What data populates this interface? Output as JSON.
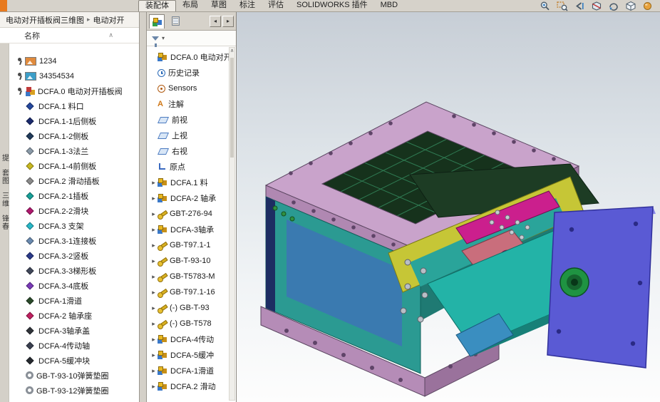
{
  "toolbar": {
    "tabs": [
      {
        "label": "装配体",
        "active": true
      },
      {
        "label": "布局",
        "active": false
      },
      {
        "label": "草图",
        "active": false
      },
      {
        "label": "标注",
        "active": false
      },
      {
        "label": "评估",
        "active": false
      },
      {
        "label": "SOLIDWORKS 插件",
        "active": false
      },
      {
        "label": "MBD",
        "active": false
      }
    ],
    "right_icons": [
      {
        "name": "zoom-to-fit-icon"
      },
      {
        "name": "zoom-area-icon"
      },
      {
        "name": "previous-view-icon"
      },
      {
        "name": "section-view-icon"
      },
      {
        "name": "rotate-view-icon"
      },
      {
        "name": "display-style-icon"
      },
      {
        "name": "edit-appearance-icon"
      }
    ]
  },
  "breadcrumb": {
    "root": "电动对开插板阀三维图",
    "separator": "▸",
    "current": "电动对开"
  },
  "side_tabs": [
    "提",
    "套图",
    "三维",
    "锋春"
  ],
  "file_panel": {
    "name_header": "名称",
    "sort_indicator": "∧",
    "items": [
      {
        "label": "1234",
        "icon": "jpg-file-icon",
        "color": "#e08a3c",
        "pinned": true
      },
      {
        "label": "34354534",
        "icon": "jpg-file-icon",
        "color": "#3c9ec8",
        "pinned": true
      },
      {
        "label": "DCFA.0 电动对开插板阀",
        "icon": "assembly-file-icon",
        "color": "#c03a3a",
        "pinned": true
      },
      {
        "label": "DCFA.1 料口",
        "icon": "part-icon",
        "color": "#24489e",
        "pinned": false
      },
      {
        "label": "DCFA.1-1后侧板",
        "icon": "part-icon",
        "color": "#1a2a6e",
        "pinned": false
      },
      {
        "label": "DCFA.1-2侧板",
        "icon": "part-icon",
        "color": "#203a5a",
        "pinned": false
      },
      {
        "label": "DCFA.1-3法兰",
        "icon": "part-icon",
        "color": "#8a9aa8",
        "pinned": false
      },
      {
        "label": "DCFA.1-4前侧板",
        "icon": "part-icon",
        "color": "#c8b820",
        "pinned": false
      },
      {
        "label": "DCFA.2 滑动插板",
        "icon": "part-icon",
        "color": "#8a8a8a",
        "pinned": false
      },
      {
        "label": "DCFA.2-1插板",
        "icon": "part-icon",
        "color": "#17a098",
        "pinned": false
      },
      {
        "label": "DCFA.2-2滑块",
        "icon": "part-icon",
        "color": "#b0186e",
        "pinned": false
      },
      {
        "label": "DCFA.3 支架",
        "icon": "part-icon",
        "color": "#28b8c8",
        "pinned": false
      },
      {
        "label": "DCFA.3-1连接板",
        "icon": "part-icon",
        "color": "#6a8ab0",
        "pinned": false
      },
      {
        "label": "DCFA.3-2竖板",
        "icon": "part-icon",
        "color": "#2a3a8a",
        "pinned": false
      },
      {
        "label": "DCFA.3-3梯形板",
        "icon": "part-icon",
        "color": "#40485a",
        "pinned": false
      },
      {
        "label": "DCFA.3-4底板",
        "icon": "part-icon",
        "color": "#7a3ab8",
        "pinned": false
      },
      {
        "label": "DCFA-1滑道",
        "icon": "part-icon",
        "color": "#2a4a2a",
        "pinned": false
      },
      {
        "label": "DCFA-2 轴承座",
        "icon": "part-icon",
        "color": "#c02060",
        "pinned": false
      },
      {
        "label": "DCFA-3轴承盖",
        "icon": "part-icon",
        "color": "#30343a",
        "pinned": false
      },
      {
        "label": "DCFA-4传动轴",
        "icon": "part-icon",
        "color": "#3a4050",
        "pinned": false
      },
      {
        "label": "DCFA-5缓冲块",
        "icon": "part-icon",
        "color": "#262a30",
        "pinned": false
      },
      {
        "label": "GB-T-93-10弹簧垫圈",
        "icon": "spring-washer-icon",
        "color": "#8a9098",
        "pinned": false
      },
      {
        "label": "GB-T-93-12弹簧垫圈",
        "icon": "spring-washer-icon",
        "color": "#8a9098",
        "pinned": false
      }
    ]
  },
  "feature_tree": {
    "tabs": [
      {
        "name": "featuremanager-tab"
      },
      {
        "name": "displaymanager-tab"
      }
    ],
    "nav": {
      "back": "◂",
      "forward": "▸"
    },
    "filter_caret": "▾",
    "scroll_up": "∧",
    "items": [
      {
        "label": "DCFA.0 电动对开",
        "icon": "assembly-icon",
        "expand": false
      },
      {
        "label": "历史记录",
        "icon": "history-icon",
        "expand": false
      },
      {
        "label": "Sensors",
        "icon": "sensors-icon",
        "expand": false
      },
      {
        "label": "注解",
        "icon": "annotations-icon",
        "expand": false
      },
      {
        "label": "前视",
        "icon": "plane-icon",
        "expand": false
      },
      {
        "label": "上视",
        "icon": "plane-icon",
        "expand": false
      },
      {
        "label": "右视",
        "icon": "plane-icon",
        "expand": false
      },
      {
        "label": "原点",
        "icon": "origin-icon",
        "expand": false
      },
      {
        "label": "DCFA.1 料",
        "icon": "component-icon",
        "expand": true
      },
      {
        "label": "DCFA-2 轴承",
        "icon": "component-icon",
        "expand": true
      },
      {
        "label": "GBT-276-94",
        "icon": "screw-icon",
        "expand": true
      },
      {
        "label": "DCFA-3轴承",
        "icon": "component-icon",
        "expand": true
      },
      {
        "label": "GB-T97.1-1",
        "icon": "screw-icon",
        "expand": true
      },
      {
        "label": "GB-T-93-10",
        "icon": "screw-icon",
        "expand": true
      },
      {
        "label": "GB-T5783-M",
        "icon": "screw-icon",
        "expand": true
      },
      {
        "label": "GB-T97.1-16",
        "icon": "screw-icon",
        "expand": true
      },
      {
        "label": "(-) GB-T-93",
        "icon": "screw-icon",
        "expand": true
      },
      {
        "label": "(-) GB-T578",
        "icon": "screw-icon",
        "expand": true
      },
      {
        "label": "DCFA-4传动",
        "icon": "component-icon",
        "expand": true
      },
      {
        "label": "DCFA-5缓冲",
        "icon": "component-icon",
        "expand": true
      },
      {
        "label": "DCFA-1滑道",
        "icon": "component-icon",
        "expand": true
      },
      {
        "label": "DCFA.2 滑动",
        "icon": "component-icon",
        "expand": true
      }
    ]
  },
  "viewport": {
    "part_colors": {
      "flange": "#c9a3cb",
      "body": "#2b9a92",
      "frame": "#c6c636",
      "slide": "#23b3a7",
      "plate": "#5a5ad4",
      "bearing": "#1f9342",
      "lever": "#cb1f8d",
      "block": "#c96e7c",
      "chute": "#1d3c24"
    }
  }
}
